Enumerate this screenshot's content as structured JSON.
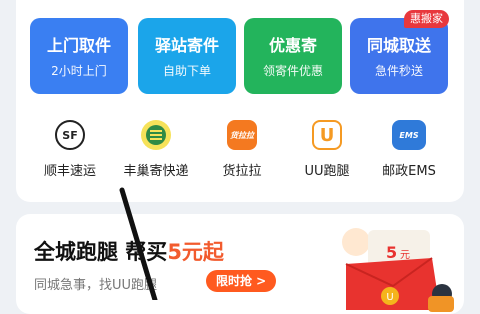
{
  "services": [
    {
      "title": "上门取件",
      "subtitle": "2小时上门"
    },
    {
      "title": "驿站寄件",
      "subtitle": "自助下单"
    },
    {
      "title": "优惠寄",
      "subtitle": "领寄件优惠"
    },
    {
      "title": "同城取送",
      "subtitle": "急件秒送"
    }
  ],
  "badge": "惠搬家",
  "couriers": [
    {
      "name": "顺丰速运",
      "icon": "sf-express-icon"
    },
    {
      "name": "丰巢寄快递",
      "icon": "hive-box-icon"
    },
    {
      "name": "货拉拉",
      "icon": "lalamove-icon"
    },
    {
      "name": "UU跑腿",
      "icon": "uu-errand-icon"
    },
    {
      "name": "邮政EMS",
      "icon": "ems-icon"
    }
  ],
  "icon_text": {
    "sf": "SF",
    "lalamove": "货拉拉",
    "uu": "U",
    "ems": "EMS"
  },
  "promo": {
    "title": "全城跑腿 帮买",
    "price": "5元起",
    "subtitle": "同城急事，找UU跑腿",
    "button": "限时抢 >",
    "coupon_value": "5",
    "coupon_unit": "元"
  },
  "colors": {
    "service_1": "#3a7ff2",
    "service_2": "#1ba5ea",
    "service_3": "#23b45c",
    "service_4": "#3f74ec",
    "badge": "#e8383d",
    "promo_accent": "#f25b2e"
  }
}
